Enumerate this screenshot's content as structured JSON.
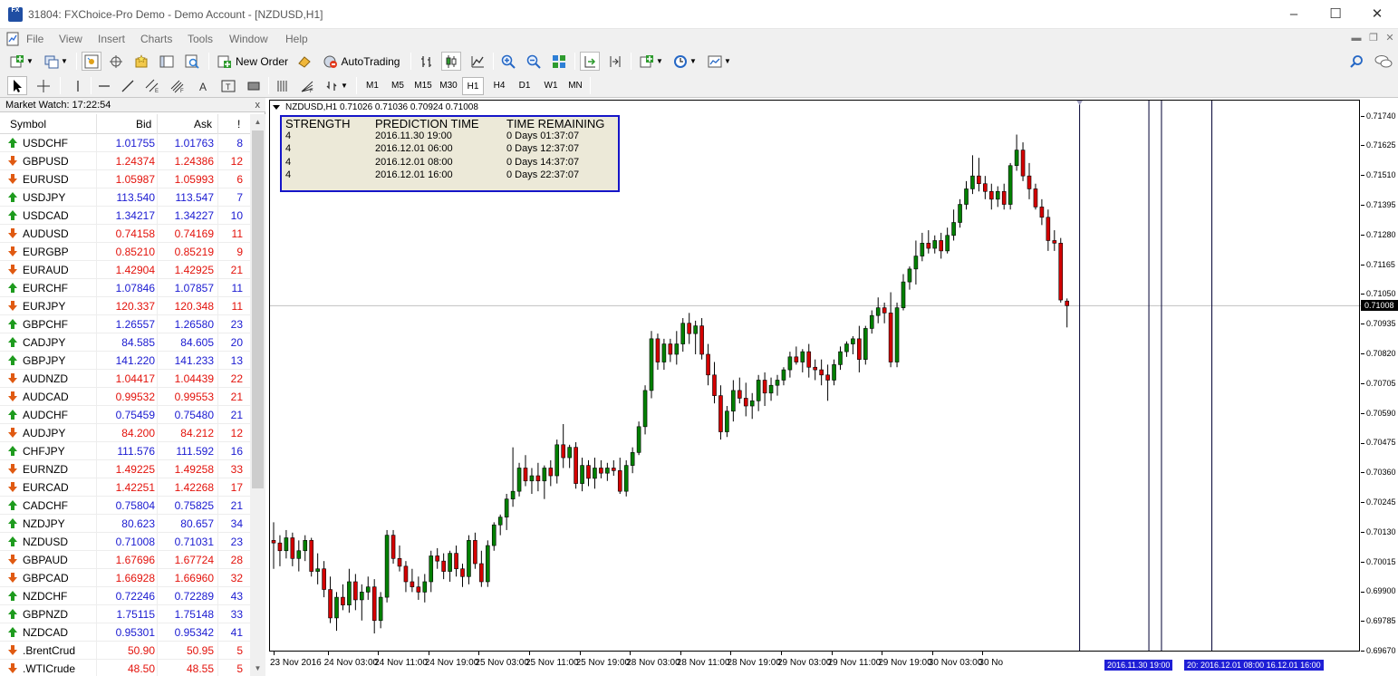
{
  "window": {
    "title": "31804: FXChoice-Pro Demo - Demo Account - [NZDUSD,H1]",
    "icon_text": "FX"
  },
  "menu": [
    "File",
    "View",
    "Insert",
    "Charts",
    "Tools",
    "Window",
    "Help"
  ],
  "toolbar": {
    "new_order_label": "New Order",
    "autotrading_label": "AutoTrading"
  },
  "timeframes": [
    "M1",
    "M5",
    "M15",
    "M30",
    "H1",
    "H4",
    "D1",
    "W1",
    "MN"
  ],
  "active_timeframe": "H1",
  "market_watch": {
    "title": "Market Watch: 17:22:54",
    "close": "x",
    "columns": {
      "symbol": "Symbol",
      "bid": "Bid",
      "ask": "Ask",
      "spread": "!"
    },
    "colors": {
      "up": "#1a1ad1",
      "down": "#e3120b",
      "up_arrow": "#1e9b1e",
      "down_arrow": "#e05a12"
    },
    "rows": [
      {
        "symbol": "USDCHF",
        "bid": "1.01755",
        "ask": "1.01763",
        "spread": "8",
        "dir": "up"
      },
      {
        "symbol": "GBPUSD",
        "bid": "1.24374",
        "ask": "1.24386",
        "spread": "12",
        "dir": "down"
      },
      {
        "symbol": "EURUSD",
        "bid": "1.05987",
        "ask": "1.05993",
        "spread": "6",
        "dir": "down"
      },
      {
        "symbol": "USDJPY",
        "bid": "113.540",
        "ask": "113.547",
        "spread": "7",
        "dir": "up"
      },
      {
        "symbol": "USDCAD",
        "bid": "1.34217",
        "ask": "1.34227",
        "spread": "10",
        "dir": "up"
      },
      {
        "symbol": "AUDUSD",
        "bid": "0.74158",
        "ask": "0.74169",
        "spread": "11",
        "dir": "down"
      },
      {
        "symbol": "EURGBP",
        "bid": "0.85210",
        "ask": "0.85219",
        "spread": "9",
        "dir": "down"
      },
      {
        "symbol": "EURAUD",
        "bid": "1.42904",
        "ask": "1.42925",
        "spread": "21",
        "dir": "down"
      },
      {
        "symbol": "EURCHF",
        "bid": "1.07846",
        "ask": "1.07857",
        "spread": "11",
        "dir": "up"
      },
      {
        "symbol": "EURJPY",
        "bid": "120.337",
        "ask": "120.348",
        "spread": "11",
        "dir": "down"
      },
      {
        "symbol": "GBPCHF",
        "bid": "1.26557",
        "ask": "1.26580",
        "spread": "23",
        "dir": "up"
      },
      {
        "symbol": "CADJPY",
        "bid": "84.585",
        "ask": "84.605",
        "spread": "20",
        "dir": "up"
      },
      {
        "symbol": "GBPJPY",
        "bid": "141.220",
        "ask": "141.233",
        "spread": "13",
        "dir": "up"
      },
      {
        "symbol": "AUDNZD",
        "bid": "1.04417",
        "ask": "1.04439",
        "spread": "22",
        "dir": "down"
      },
      {
        "symbol": "AUDCAD",
        "bid": "0.99532",
        "ask": "0.99553",
        "spread": "21",
        "dir": "down"
      },
      {
        "symbol": "AUDCHF",
        "bid": "0.75459",
        "ask": "0.75480",
        "spread": "21",
        "dir": "up"
      },
      {
        "symbol": "AUDJPY",
        "bid": "84.200",
        "ask": "84.212",
        "spread": "12",
        "dir": "down"
      },
      {
        "symbol": "CHFJPY",
        "bid": "111.576",
        "ask": "111.592",
        "spread": "16",
        "dir": "up"
      },
      {
        "symbol": "EURNZD",
        "bid": "1.49225",
        "ask": "1.49258",
        "spread": "33",
        "dir": "down"
      },
      {
        "symbol": "EURCAD",
        "bid": "1.42251",
        "ask": "1.42268",
        "spread": "17",
        "dir": "down"
      },
      {
        "symbol": "CADCHF",
        "bid": "0.75804",
        "ask": "0.75825",
        "spread": "21",
        "dir": "up"
      },
      {
        "symbol": "NZDJPY",
        "bid": "80.623",
        "ask": "80.657",
        "spread": "34",
        "dir": "up"
      },
      {
        "symbol": "NZDUSD",
        "bid": "0.71008",
        "ask": "0.71031",
        "spread": "23",
        "dir": "up"
      },
      {
        "symbol": "GBPAUD",
        "bid": "1.67696",
        "ask": "1.67724",
        "spread": "28",
        "dir": "down"
      },
      {
        "symbol": "GBPCAD",
        "bid": "1.66928",
        "ask": "1.66960",
        "spread": "32",
        "dir": "down"
      },
      {
        "symbol": "NZDCHF",
        "bid": "0.72246",
        "ask": "0.72289",
        "spread": "43",
        "dir": "up"
      },
      {
        "symbol": "GBPNZD",
        "bid": "1.75115",
        "ask": "1.75148",
        "spread": "33",
        "dir": "up"
      },
      {
        "symbol": "NZDCAD",
        "bid": "0.95301",
        "ask": "0.95342",
        "spread": "41",
        "dir": "up"
      },
      {
        "symbol": ".BrentCrud",
        "bid": "50.90",
        "ask": "50.95",
        "spread": "5",
        "dir": "down"
      },
      {
        "symbol": ".WTICrude",
        "bid": "48.50",
        "ask": "48.55",
        "spread": "5",
        "dir": "down"
      }
    ]
  },
  "chart_header": "NZDUSD,H1  0.71026 0.71036 0.70924 0.71008",
  "prediction_panel": {
    "headers": [
      "STRENGTH",
      "PREDICTION TIME",
      "TIME REMAINING"
    ],
    "rows": [
      [
        "4",
        "2016.11.30 19:00",
        "0 Days 01:37:07"
      ],
      [
        "4",
        "2016.12.01 06:00",
        "0 Days 12:37:07"
      ],
      [
        "4",
        "2016.12.01 08:00",
        "0 Days 14:37:07"
      ],
      [
        "4",
        "2016.12.01 16:00",
        "0 Days 22:37:07"
      ]
    ]
  },
  "time_flags": [
    "2016.11.30 19:00",
    "20: 2016.12.01 08:00 16.12.01 16:00"
  ],
  "chart_data": {
    "type": "candlestick",
    "symbol": "NZDUSD",
    "timeframe": "H1",
    "current_price": "0.71008",
    "ohlc_header": {
      "open": 0.71026,
      "high": 0.71036,
      "low": 0.70924,
      "close": 0.71008
    },
    "y_ticks": [
      "0.71740",
      "0.71625",
      "0.71510",
      "0.71395",
      "0.71280",
      "0.71165",
      "0.71050",
      "0.70935",
      "0.70820",
      "0.70705",
      "0.70590",
      "0.70475",
      "0.70360",
      "0.70245",
      "0.70130",
      "0.70015",
      "0.69900",
      "0.69785",
      "0.69670"
    ],
    "ylim": [
      0.6967,
      0.7177
    ],
    "x_ticks": [
      "23 Nov 2016",
      "24 Nov 03:00",
      "24 Nov 11:00",
      "24 Nov 19:00",
      "25 Nov 03:00",
      "25 Nov 11:00",
      "25 Nov 19:00",
      "28 Nov 03:00",
      "28 Nov 11:00",
      "28 Nov 19:00",
      "29 Nov 03:00",
      "29 Nov 11:00",
      "29 Nov 19:00",
      "30 Nov 03:00",
      "30 No"
    ],
    "colors": {
      "bull": "#008000",
      "bear": "#d40000",
      "wick": "#000000"
    },
    "candles": [
      [
        0.701,
        0.7017,
        0.6999,
        0.7009
      ],
      [
        0.7009,
        0.7012,
        0.7,
        0.7006
      ],
      [
        0.7006,
        0.7014,
        0.7003,
        0.7011
      ],
      [
        0.7011,
        0.7013,
        0.7,
        0.7003
      ],
      [
        0.7003,
        0.701,
        0.6998,
        0.7006
      ],
      [
        0.7006,
        0.7012,
        0.7002,
        0.701
      ],
      [
        0.701,
        0.7011,
        0.6996,
        0.6998
      ],
      [
        0.6998,
        0.7005,
        0.6993,
        0.6999
      ],
      [
        0.6999,
        0.7002,
        0.6988,
        0.6991
      ],
      [
        0.6991,
        0.6996,
        0.6978,
        0.698
      ],
      [
        0.698,
        0.699,
        0.6975,
        0.6988
      ],
      [
        0.6988,
        0.6993,
        0.6983,
        0.6985
      ],
      [
        0.6985,
        0.6999,
        0.6982,
        0.6994
      ],
      [
        0.6994,
        0.6997,
        0.6983,
        0.6987
      ],
      [
        0.6987,
        0.6993,
        0.6979,
        0.699
      ],
      [
        0.699,
        0.6996,
        0.6987,
        0.6992
      ],
      [
        0.6992,
        0.6995,
        0.6974,
        0.6979
      ],
      [
        0.6979,
        0.699,
        0.6976,
        0.6988
      ],
      [
        0.6988,
        0.7014,
        0.6986,
        0.7012
      ],
      [
        0.7012,
        0.7014,
        0.7001,
        0.7003
      ],
      [
        0.7003,
        0.7008,
        0.6998,
        0.7
      ],
      [
        0.7,
        0.7002,
        0.699,
        0.6994
      ],
      [
        0.6994,
        0.6999,
        0.699,
        0.6992
      ],
      [
        0.6992,
        0.6996,
        0.6987,
        0.699
      ],
      [
        0.699,
        0.6997,
        0.6986,
        0.6994
      ],
      [
        0.6994,
        0.7006,
        0.699,
        0.7004
      ],
      [
        0.7004,
        0.7007,
        0.6999,
        0.7002
      ],
      [
        0.7002,
        0.7005,
        0.6995,
        0.6998
      ],
      [
        0.6998,
        0.7006,
        0.6994,
        0.7005
      ],
      [
        0.7005,
        0.7008,
        0.6996,
        0.6999
      ],
      [
        0.6999,
        0.7001,
        0.6992,
        0.6996
      ],
      [
        0.6996,
        0.7012,
        0.6993,
        0.701
      ],
      [
        0.701,
        0.7013,
        0.6999,
        0.7001
      ],
      [
        0.7001,
        0.7006,
        0.6992,
        0.6994
      ],
      [
        0.6994,
        0.701,
        0.6992,
        0.7008
      ],
      [
        0.7008,
        0.7017,
        0.7006,
        0.7016
      ],
      [
        0.7016,
        0.702,
        0.7012,
        0.7019
      ],
      [
        0.7019,
        0.7028,
        0.7014,
        0.7026
      ],
      [
        0.7026,
        0.7046,
        0.7023,
        0.7029
      ],
      [
        0.7029,
        0.704,
        0.7027,
        0.7038
      ],
      [
        0.7038,
        0.7043,
        0.7031,
        0.7033
      ],
      [
        0.7033,
        0.7038,
        0.7028,
        0.7035
      ],
      [
        0.7035,
        0.704,
        0.7029,
        0.7033
      ],
      [
        0.7033,
        0.7039,
        0.7026,
        0.7038
      ],
      [
        0.7038,
        0.7041,
        0.7031,
        0.7035
      ],
      [
        0.7035,
        0.7049,
        0.7032,
        0.7047
      ],
      [
        0.7047,
        0.7055,
        0.7038,
        0.7042
      ],
      [
        0.7042,
        0.7047,
        0.7038,
        0.7046
      ],
      [
        0.7046,
        0.7048,
        0.703,
        0.7032
      ],
      [
        0.7032,
        0.7042,
        0.7029,
        0.7039
      ],
      [
        0.7039,
        0.7041,
        0.7031,
        0.7034
      ],
      [
        0.7034,
        0.7042,
        0.703,
        0.7038
      ],
      [
        0.7038,
        0.7041,
        0.7034,
        0.7036
      ],
      [
        0.7036,
        0.704,
        0.7033,
        0.7038
      ],
      [
        0.7038,
        0.7041,
        0.7035,
        0.7037
      ],
      [
        0.7037,
        0.7042,
        0.7028,
        0.7029
      ],
      [
        0.7029,
        0.7041,
        0.7027,
        0.7039
      ],
      [
        0.7039,
        0.7046,
        0.7036,
        0.7044
      ],
      [
        0.7044,
        0.7056,
        0.7043,
        0.7054
      ],
      [
        0.7054,
        0.707,
        0.7051,
        0.7068
      ],
      [
        0.7068,
        0.7091,
        0.7065,
        0.7088
      ],
      [
        0.7088,
        0.709,
        0.7076,
        0.7079
      ],
      [
        0.7079,
        0.7088,
        0.7076,
        0.7086
      ],
      [
        0.7086,
        0.7088,
        0.7079,
        0.7082
      ],
      [
        0.7082,
        0.7091,
        0.7078,
        0.7086
      ],
      [
        0.7086,
        0.7096,
        0.7083,
        0.7094
      ],
      [
        0.7094,
        0.7098,
        0.7086,
        0.709
      ],
      [
        0.709,
        0.7095,
        0.7082,
        0.7093
      ],
      [
        0.7093,
        0.7096,
        0.708,
        0.7082
      ],
      [
        0.7082,
        0.7086,
        0.707,
        0.7074
      ],
      [
        0.7074,
        0.7079,
        0.7063,
        0.7066
      ],
      [
        0.7066,
        0.707,
        0.7049,
        0.7052
      ],
      [
        0.7052,
        0.7062,
        0.705,
        0.706
      ],
      [
        0.706,
        0.7072,
        0.7056,
        0.7068
      ],
      [
        0.7068,
        0.7073,
        0.7063,
        0.7065
      ],
      [
        0.7065,
        0.7071,
        0.7058,
        0.7062
      ],
      [
        0.7062,
        0.7067,
        0.7057,
        0.7064
      ],
      [
        0.7064,
        0.7074,
        0.706,
        0.7072
      ],
      [
        0.7072,
        0.7075,
        0.7062,
        0.7067
      ],
      [
        0.7067,
        0.7073,
        0.7064,
        0.707
      ],
      [
        0.707,
        0.7074,
        0.7066,
        0.7072
      ],
      [
        0.7072,
        0.7077,
        0.707,
        0.7076
      ],
      [
        0.7076,
        0.7083,
        0.7073,
        0.7081
      ],
      [
        0.7081,
        0.7085,
        0.7078,
        0.7079
      ],
      [
        0.7079,
        0.7084,
        0.7075,
        0.7083
      ],
      [
        0.7083,
        0.7086,
        0.7073,
        0.7077
      ],
      [
        0.7077,
        0.708,
        0.7072,
        0.7076
      ],
      [
        0.7076,
        0.708,
        0.707,
        0.7074
      ],
      [
        0.7074,
        0.7078,
        0.7064,
        0.7072
      ],
      [
        0.7072,
        0.708,
        0.707,
        0.7078
      ],
      [
        0.7078,
        0.7085,
        0.7076,
        0.7083
      ],
      [
        0.7083,
        0.7087,
        0.7081,
        0.7086
      ],
      [
        0.7086,
        0.7089,
        0.7082,
        0.7088
      ],
      [
        0.7088,
        0.7093,
        0.7075,
        0.708
      ],
      [
        0.708,
        0.7093,
        0.7078,
        0.7092
      ],
      [
        0.7092,
        0.7099,
        0.709,
        0.7097
      ],
      [
        0.7097,
        0.7104,
        0.7094,
        0.71
      ],
      [
        0.71,
        0.7102,
        0.7094,
        0.7098
      ],
      [
        0.7098,
        0.7106,
        0.7077,
        0.7079
      ],
      [
        0.7079,
        0.7102,
        0.7077,
        0.71
      ],
      [
        0.71,
        0.7113,
        0.7099,
        0.711
      ],
      [
        0.711,
        0.7116,
        0.7107,
        0.7115
      ],
      [
        0.7115,
        0.7126,
        0.7109,
        0.712
      ],
      [
        0.712,
        0.7129,
        0.7118,
        0.7125
      ],
      [
        0.7125,
        0.713,
        0.7121,
        0.7123
      ],
      [
        0.7123,
        0.7128,
        0.7121,
        0.7126
      ],
      [
        0.7126,
        0.7129,
        0.7119,
        0.7122
      ],
      [
        0.7122,
        0.7131,
        0.7121,
        0.7128
      ],
      [
        0.7128,
        0.7138,
        0.7126,
        0.7133
      ],
      [
        0.7133,
        0.7142,
        0.7131,
        0.714
      ],
      [
        0.714,
        0.7149,
        0.7138,
        0.7146
      ],
      [
        0.7146,
        0.7159,
        0.7144,
        0.7151
      ],
      [
        0.7151,
        0.7158,
        0.7145,
        0.7148
      ],
      [
        0.7148,
        0.7151,
        0.7142,
        0.7145
      ],
      [
        0.7145,
        0.7148,
        0.7138,
        0.7142
      ],
      [
        0.7142,
        0.7147,
        0.7139,
        0.7145
      ],
      [
        0.7145,
        0.7148,
        0.7138,
        0.714
      ],
      [
        0.714,
        0.7156,
        0.7138,
        0.7155
      ],
      [
        0.7155,
        0.7167,
        0.7153,
        0.7161
      ],
      [
        0.7161,
        0.7164,
        0.7149,
        0.7151
      ],
      [
        0.7151,
        0.7156,
        0.7142,
        0.7146
      ],
      [
        0.7146,
        0.7148,
        0.7138,
        0.7139
      ],
      [
        0.7139,
        0.7142,
        0.7132,
        0.7135
      ],
      [
        0.7135,
        0.7138,
        0.7122,
        0.7126
      ],
      [
        0.7126,
        0.713,
        0.7122,
        0.7125
      ],
      [
        0.7125,
        0.7127,
        0.7102,
        0.7103
      ],
      [
        0.71026,
        0.71036,
        0.70924,
        0.71008
      ]
    ],
    "markers": [
      {
        "label": "2016.11.30 19:00",
        "time": "2016.11.30 19:00"
      },
      {
        "time": "2016.12.01 06:00"
      },
      {
        "time": "2016.12.01 08:00"
      },
      {
        "time": "2016.12.01 16:00"
      }
    ]
  }
}
